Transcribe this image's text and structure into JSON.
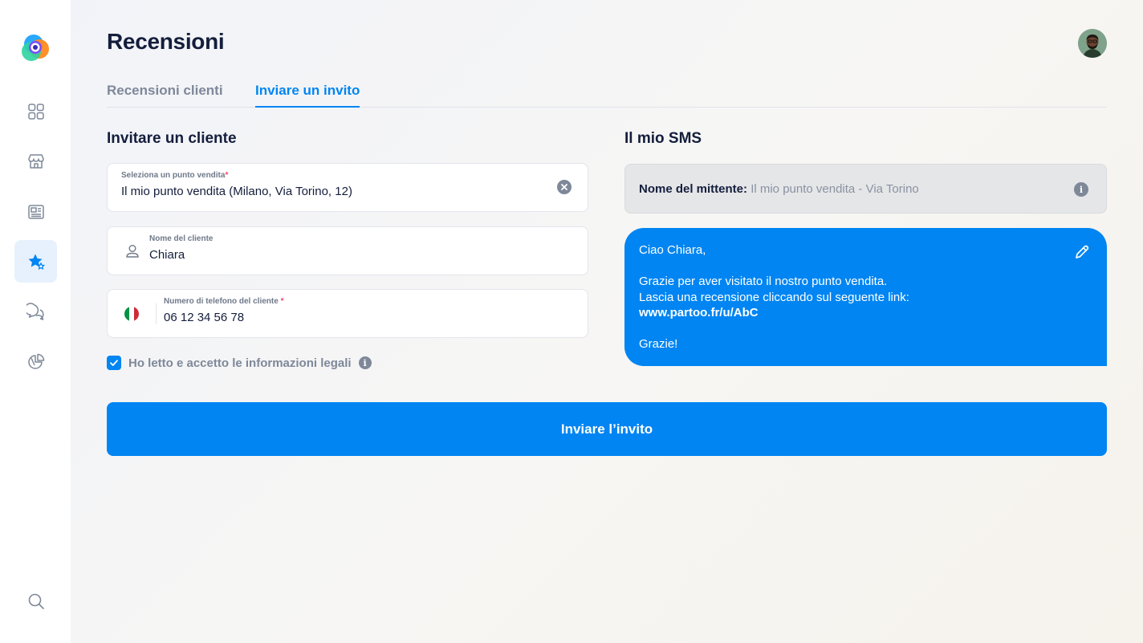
{
  "app": {
    "title": "Recensioni"
  },
  "sidebar": {
    "items": [
      {
        "name": "dashboard",
        "icon": "grid-icon"
      },
      {
        "name": "store",
        "icon": "store-icon"
      },
      {
        "name": "posts",
        "icon": "newspaper-icon"
      },
      {
        "name": "reviews",
        "icon": "star-icon",
        "active": true
      },
      {
        "name": "messages",
        "icon": "chat-bubbles-icon"
      },
      {
        "name": "analytics",
        "icon": "pie-chart-icon"
      }
    ],
    "search_icon": "search-icon"
  },
  "tabs": [
    {
      "label": "Recensioni clienti",
      "active": false
    },
    {
      "label": "Inviare un invito",
      "active": true
    }
  ],
  "invite": {
    "title": "Invitare un cliente",
    "store_select": {
      "label": "Seleziona un punto vendita",
      "required_mark": "*",
      "value": "Il mio punto vendita (Milano, Via Torino, 12)"
    },
    "customer_name": {
      "label": "Nome del cliente",
      "value": "Chiara"
    },
    "phone": {
      "label": "Numero di telefono del cliente",
      "required_mark": "*",
      "country": "IT",
      "value": "06 12 34 56 78"
    },
    "consent": {
      "checked": true,
      "label": "Ho letto e accetto le informazioni legali",
      "info_icon": "i"
    }
  },
  "sms": {
    "title": "Il mio SMS",
    "sender_label": "Nome del mittente:",
    "sender_value": "Il mio punto vendita - Via Torino",
    "info_icon": "i",
    "greeting": "Ciao Chiara,",
    "line1": "Grazie per aver visitato il nostro punto vendita.",
    "line2": "Lascia una recensione cliccando sul seguente link:",
    "link": "www.partoo.fr/u/AbC",
    "closing": "Grazie!"
  },
  "actions": {
    "send_label": "Inviare l’invito"
  },
  "colors": {
    "accent": "#0085f2",
    "text_dark": "#141e3c",
    "text_muted": "#7e8899",
    "required": "#ff426e"
  }
}
